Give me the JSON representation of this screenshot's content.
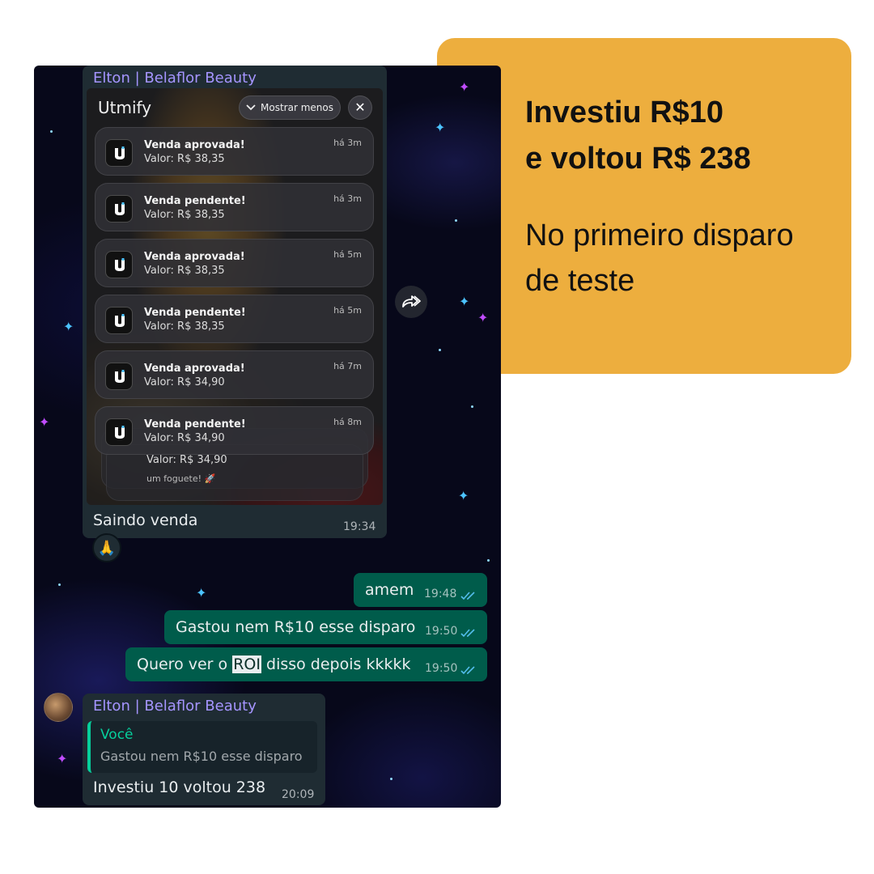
{
  "callout": {
    "headline_line1": "Investiu R$10",
    "headline_line2": "e voltou R$ 238",
    "sub_line1": "No primeiro disparo",
    "sub_line2": "de teste",
    "color": "#EDAE3E"
  },
  "chat": {
    "message1": {
      "sender": "Elton | Belaflor Beauty",
      "image": {
        "app_title": "Utmify",
        "collapse_label": "Mostrar menos",
        "close_icon": "close-icon",
        "notifications": [
          {
            "title": "Venda aprovada!",
            "value": "Valor: R$ 38,35",
            "time": "há 3m"
          },
          {
            "title": "Venda pendente!",
            "value": "Valor: R$ 38,35",
            "time": "há 3m"
          },
          {
            "title": "Venda aprovada!",
            "value": "Valor: R$ 38,35",
            "time": "há 5m"
          },
          {
            "title": "Venda pendente!",
            "value": "Valor: R$ 38,35",
            "time": "há 5m"
          },
          {
            "title": "Venda aprovada!",
            "value": "Valor: R$ 34,90",
            "time": "há 7m"
          },
          {
            "title": "Venda pendente!",
            "value": "Valor: R$ 34,90",
            "time": "há 8m"
          }
        ],
        "stacked_value": "Valor: R$ 34,90",
        "stacked_snippet": "um foguete! 🚀"
      },
      "caption": "Saindo venda",
      "time": "19:34",
      "reaction": "🙏"
    },
    "outgoing": [
      {
        "text": "amem",
        "time": "19:48"
      },
      {
        "text": "Gastou nem R$10 esse disparo",
        "time": "19:50"
      },
      {
        "text_before": "Quero ver o ",
        "highlight": "ROI",
        "text_after": " disso depois kkkkk",
        "time": "19:50"
      }
    ],
    "message_last": {
      "sender": "Elton | Belaflor Beauty",
      "quote_author": "Você",
      "quote_text": "Gastou nem R$10 esse disparo",
      "text": "Investiu 10 voltou 238",
      "time": "20:09"
    },
    "colors": {
      "incoming_bubble": "#1f2c33",
      "outgoing_bubble": "#005c4b",
      "sender_name": "#a595ff",
      "read_ticks": "#53bdeb"
    }
  }
}
